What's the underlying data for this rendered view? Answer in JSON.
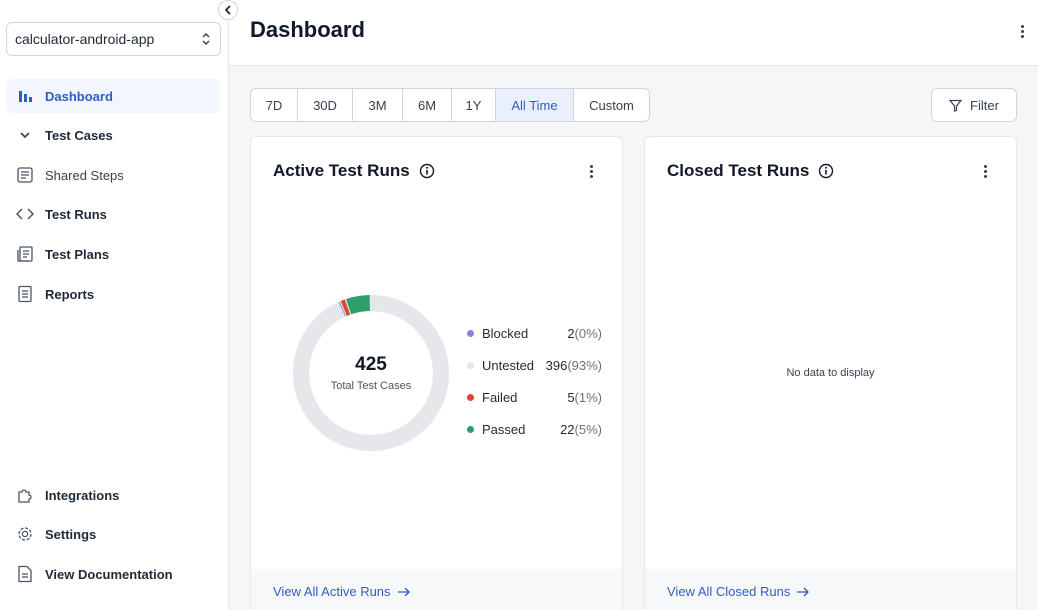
{
  "sidebar": {
    "project": "calculator-android-app",
    "items": [
      {
        "label": "Dashboard"
      },
      {
        "label": "Test Cases"
      },
      {
        "label": "Shared Steps"
      },
      {
        "label": "Test Runs"
      },
      {
        "label": "Test Plans"
      },
      {
        "label": "Reports"
      }
    ],
    "bottom_items": [
      {
        "label": "Integrations"
      },
      {
        "label": "Settings"
      },
      {
        "label": "View Documentation"
      }
    ]
  },
  "header": {
    "title": "Dashboard"
  },
  "ranges": {
    "options": [
      "7D",
      "30D",
      "3M",
      "6M",
      "1Y",
      "All Time",
      "Custom"
    ],
    "selected": "All Time"
  },
  "filter": {
    "label": "Filter"
  },
  "active_card": {
    "title": "Active Test Runs",
    "total": "425",
    "total_label": "Total Test Cases",
    "legend": [
      {
        "name": "Blocked",
        "count": "2",
        "pct": "(0%)",
        "color": "#8b7fe0"
      },
      {
        "name": "Untested",
        "count": "396",
        "pct": "(93%)",
        "color": "#e5e7eb"
      },
      {
        "name": "Failed",
        "count": "5",
        "pct": "(1%)",
        "color": "#d94a2b"
      },
      {
        "name": "Passed",
        "count": "22",
        "pct": "(5%)",
        "color": "#2e9e6b"
      }
    ],
    "footer_link": "View All Active Runs"
  },
  "closed_card": {
    "title": "Closed Test Runs",
    "empty_text": "No data to display",
    "footer_link": "View All Closed Runs"
  },
  "colors": {
    "accent": "#2f5ec4",
    "passed": "#2e9e6b",
    "failed": "#d94a2b",
    "blocked": "#8b7fe0",
    "untested": "#e5e7eb"
  },
  "chart_data": {
    "type": "pie",
    "categories": [
      "Blocked",
      "Untested",
      "Failed",
      "Passed"
    ],
    "values": [
      2,
      396,
      5,
      22
    ]
  }
}
